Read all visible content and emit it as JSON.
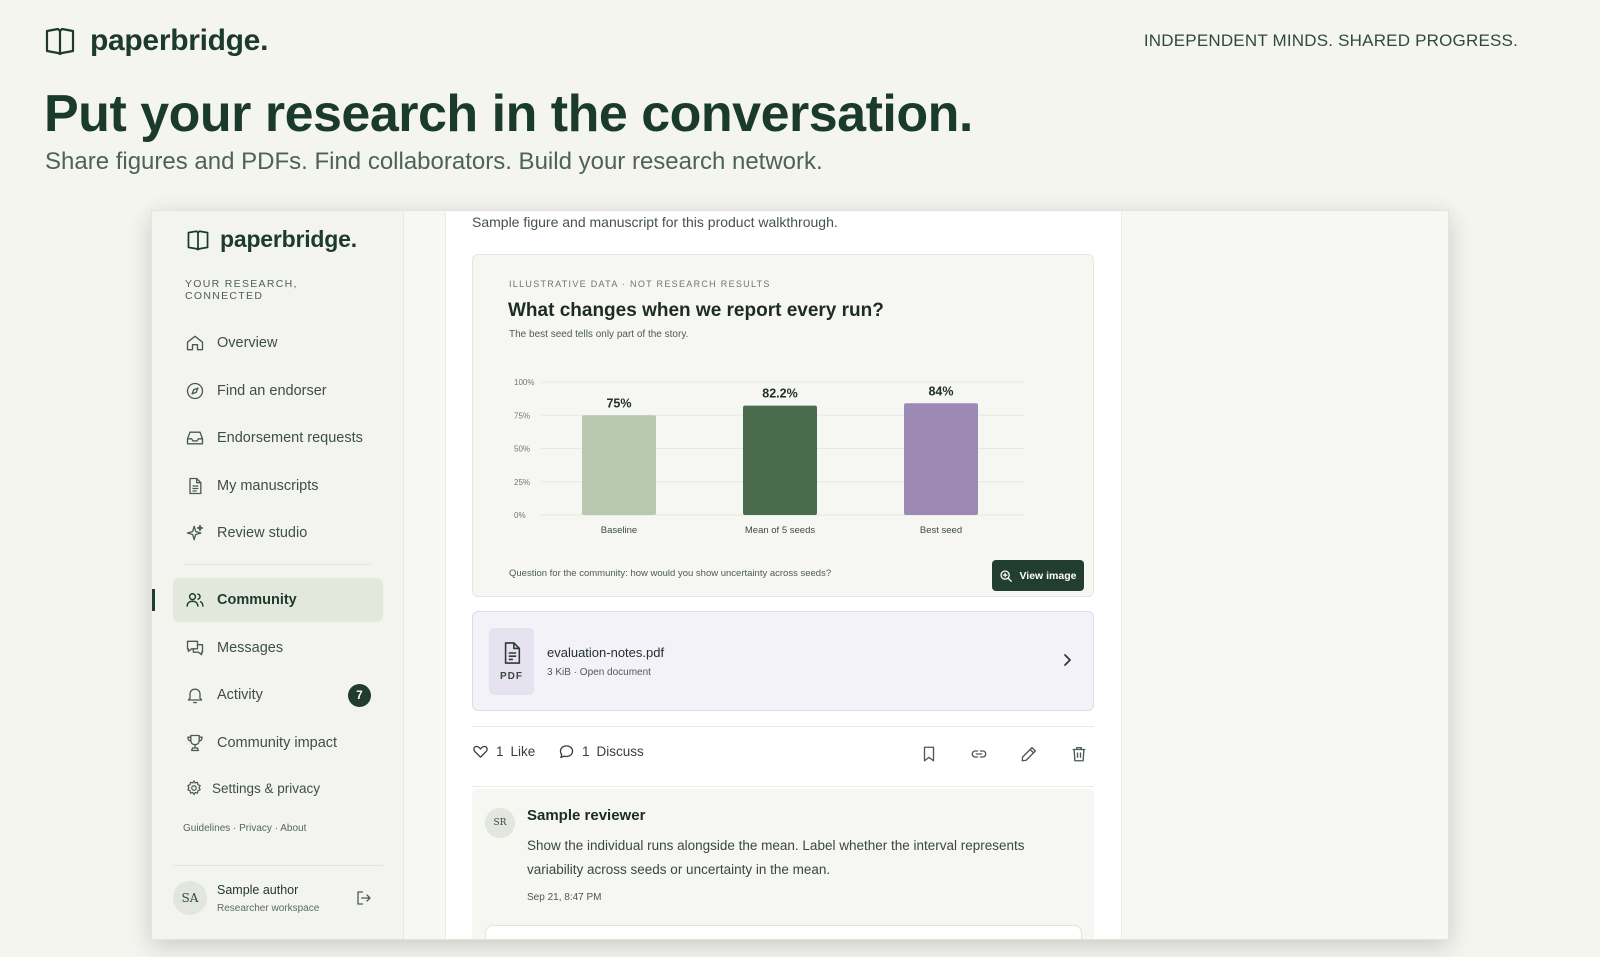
{
  "brand": {
    "name": "paperbridge",
    "dot": ".",
    "tagline": "INDEPENDENT MINDS. SHARED PROGRESS."
  },
  "hero": {
    "title": "Put your research in the conversation.",
    "subtitle": "Share figures and PDFs. Find collaborators. Build your research network."
  },
  "app": {
    "sidebar": {
      "brand": "paperbridge",
      "dot": ".",
      "tagline": "YOUR RESEARCH, CONNECTED",
      "nav": [
        {
          "label": "Overview",
          "icon": "home-icon"
        },
        {
          "label": "Find an endorser",
          "icon": "compass-icon"
        },
        {
          "label": "Endorsement requests",
          "icon": "inbox-icon"
        },
        {
          "label": "My manuscripts",
          "icon": "document-icon"
        },
        {
          "label": "Review studio",
          "icon": "sparkle-icon"
        }
      ],
      "nav2": [
        {
          "label": "Community",
          "icon": "users-icon",
          "active": true
        },
        {
          "label": "Messages",
          "icon": "chat-icon"
        },
        {
          "label": "Activity",
          "icon": "bell-icon",
          "badge": "7"
        },
        {
          "label": "Community impact",
          "icon": "trophy-icon"
        }
      ],
      "settings": "Settings & privacy",
      "footer_links": "Guidelines · Privacy · About",
      "user": {
        "initials": "SA",
        "name": "Sample author",
        "role": "Researcher workspace"
      }
    },
    "post": {
      "caption": "Sample figure and manuscript for this product walkthrough.",
      "figure": {
        "eyebrow": "ILLUSTRATIVE DATA · NOT RESEARCH RESULTS",
        "title": "What changes when we report every run?",
        "subtitle": "The best seed tells only part of the story.",
        "question": "Question for the community: how would you show uncertainty across seeds?",
        "view_button": "View image"
      },
      "attachment": {
        "tag": "PDF",
        "filename": "evaluation-notes.pdf",
        "meta": "3 KiB · Open document"
      },
      "actions": {
        "like_count": "1",
        "like_label": "Like",
        "discuss_count": "1",
        "discuss_label": "Discuss"
      },
      "comment": {
        "initials": "SR",
        "author": "Sample reviewer",
        "body": "Show the individual runs alongside the mean. Label whether the interval represents variability across seeds or uncertainty in the mean.",
        "time": "Sep 21, 8:47 PM"
      }
    }
  },
  "chart_data": {
    "type": "bar",
    "categories": [
      "Baseline",
      "Mean of 5 seeds",
      "Best seed"
    ],
    "values": [
      75,
      82.2,
      84
    ],
    "value_labels": [
      "75%",
      "82.2%",
      "84%"
    ],
    "colors": [
      "#b8c8b0",
      "#4a6b4c",
      "#9d8ab4"
    ],
    "yticks": [
      "100%",
      "75%",
      "50%",
      "25%",
      "0%"
    ],
    "ytick_values": [
      100,
      75,
      50,
      25,
      0
    ],
    "ylim": [
      0,
      100
    ],
    "grid": true
  },
  "colors": {
    "accent": "#1f3d30",
    "badge": "#203c30",
    "pdf_bg": "#f4f2f9"
  }
}
